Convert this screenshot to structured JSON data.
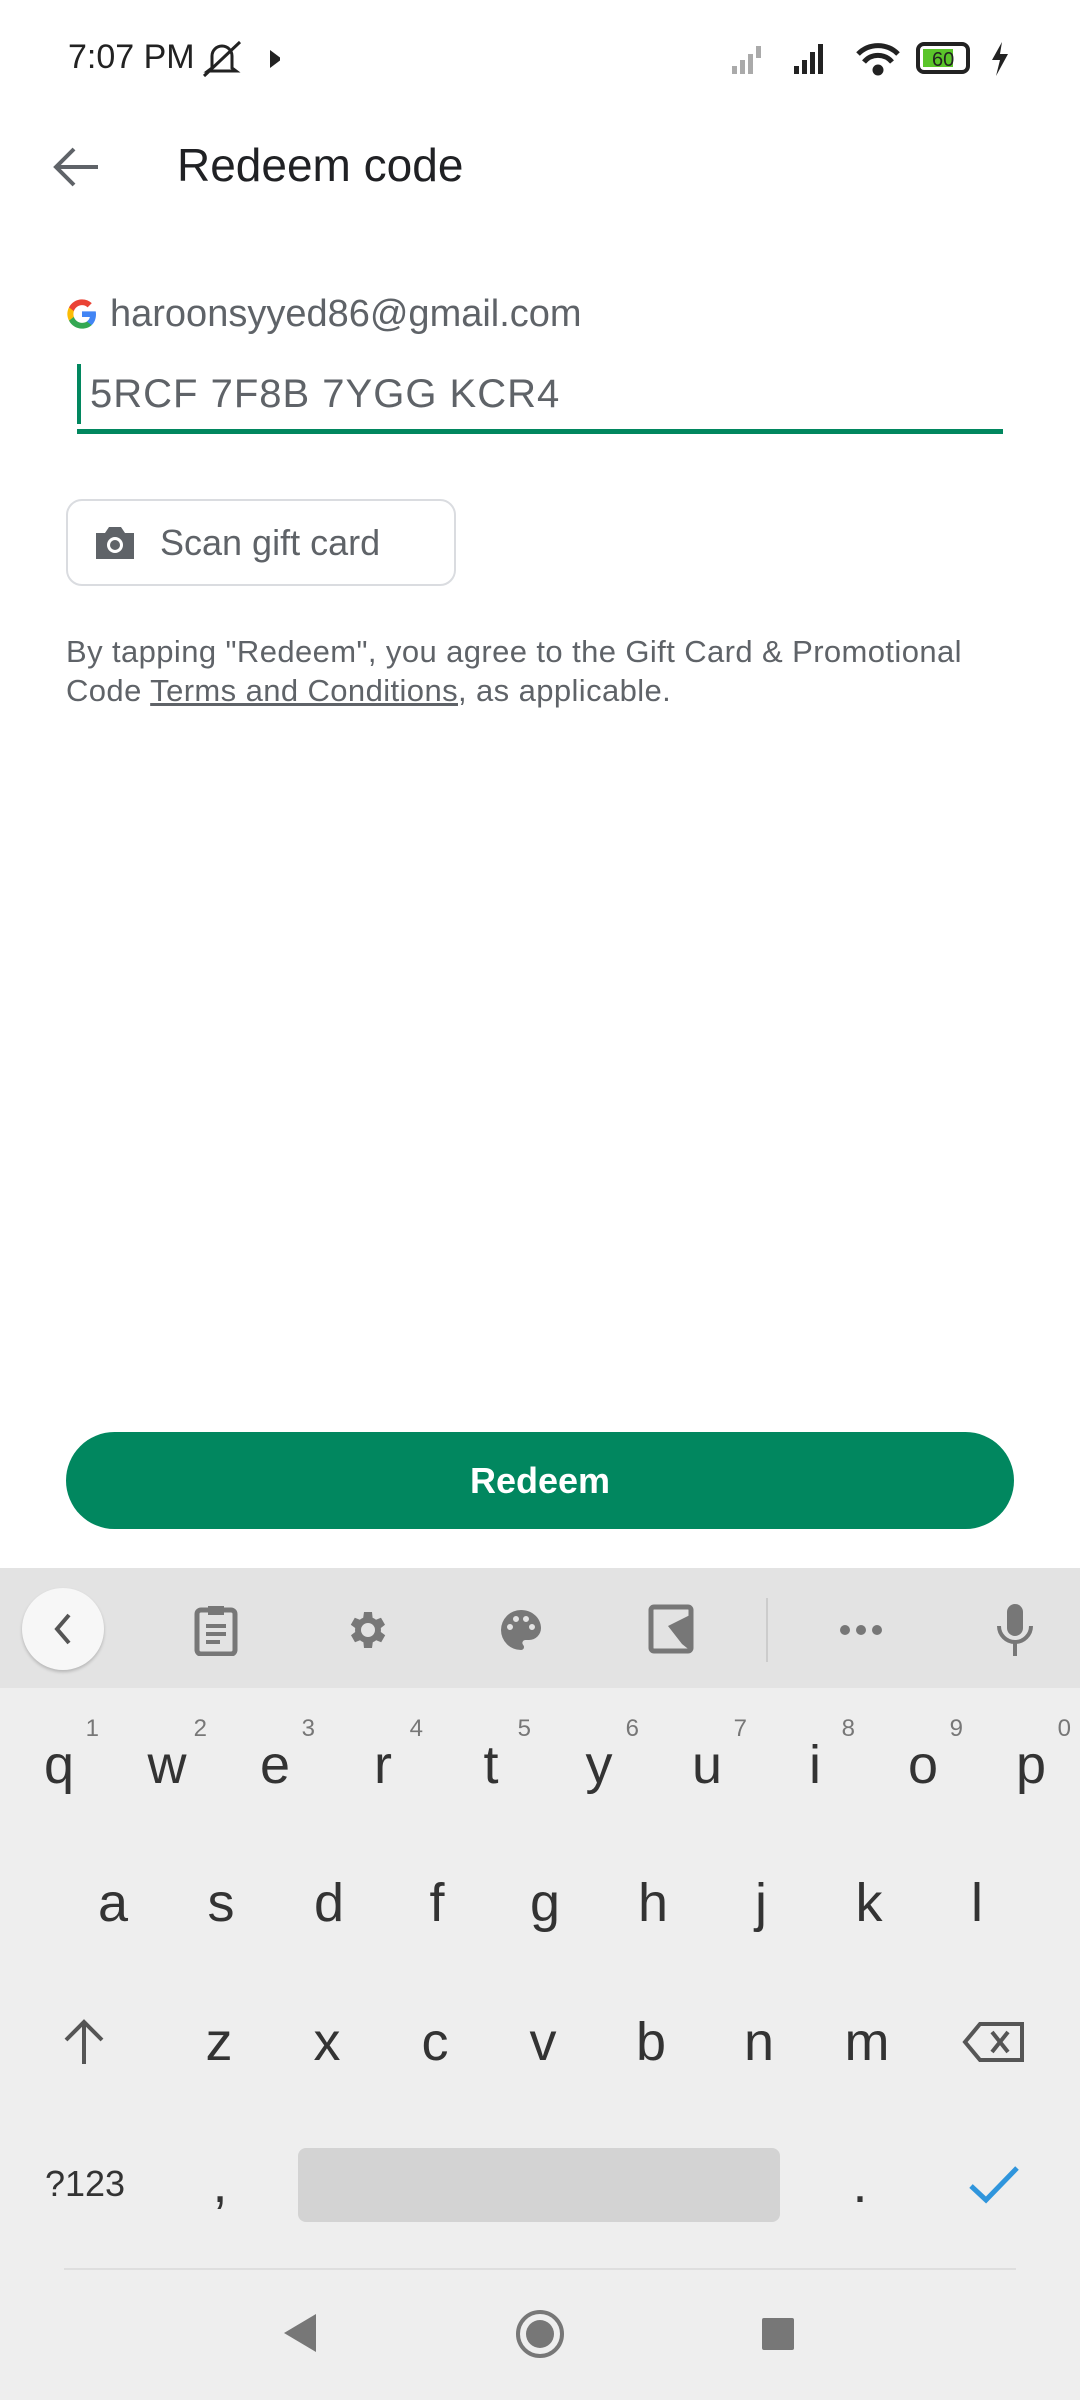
{
  "status_bar": {
    "time": "7:07 PM",
    "battery": "60",
    "icons": [
      "mute-icon",
      "play-store-icon",
      "no-signal-icon",
      "signal-icon",
      "wifi-icon",
      "battery-icon",
      "charging-icon"
    ]
  },
  "header": {
    "title": "Redeem code",
    "back_icon": "arrow-back-icon"
  },
  "account": {
    "email": "haroonsyyed86@gmail.com"
  },
  "code_input": {
    "value": "5RCF 7F8B 7YGG KCR4"
  },
  "scan_button": {
    "label": "Scan gift card"
  },
  "terms": {
    "prefix": "By tapping \"Redeem\", you agree to the Gift Card & Promotional Code ",
    "link": "Terms and Conditions",
    "suffix": ", as applicable."
  },
  "redeem_button": {
    "label": "Redeem"
  },
  "colors": {
    "accent": "#01875f"
  },
  "keyboard": {
    "row1": [
      {
        "k": "q",
        "h": "1"
      },
      {
        "k": "w",
        "h": "2"
      },
      {
        "k": "e",
        "h": "3"
      },
      {
        "k": "r",
        "h": "4"
      },
      {
        "k": "t",
        "h": "5"
      },
      {
        "k": "y",
        "h": "6"
      },
      {
        "k": "u",
        "h": "7"
      },
      {
        "k": "i",
        "h": "8"
      },
      {
        "k": "o",
        "h": "9"
      },
      {
        "k": "p",
        "h": "0"
      }
    ],
    "row2": [
      "a",
      "s",
      "d",
      "f",
      "g",
      "h",
      "j",
      "k",
      "l"
    ],
    "row3": [
      "z",
      "x",
      "c",
      "v",
      "b",
      "n",
      "m"
    ],
    "symbols": "?123",
    "comma": ",",
    "period": "."
  }
}
